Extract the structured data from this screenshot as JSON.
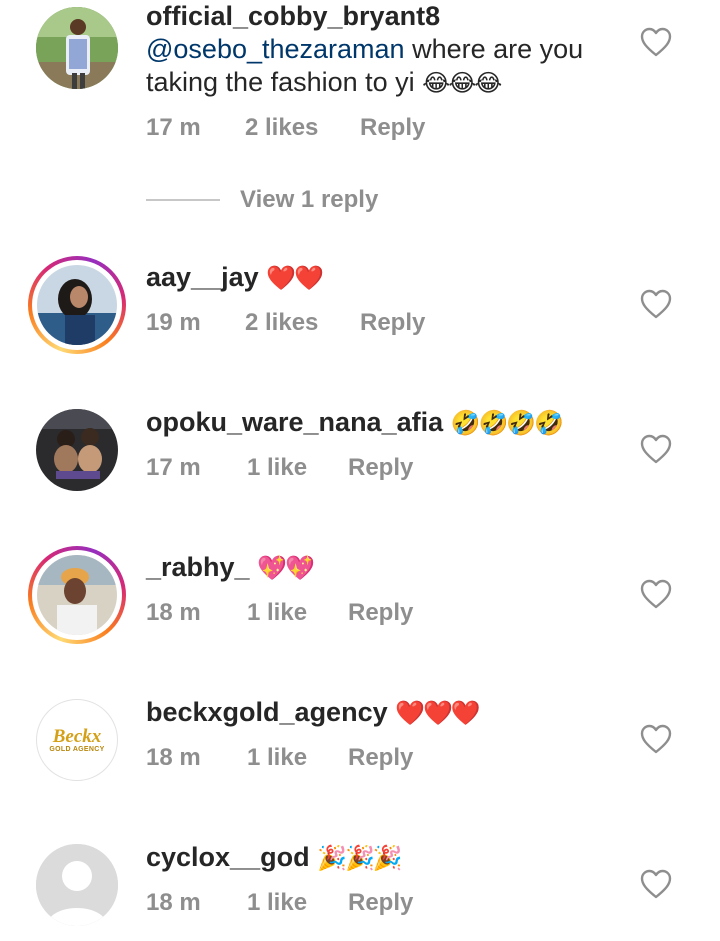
{
  "comments": [
    {
      "username": "official_cobby_bryant8",
      "mention": "@osebo_thezaraman",
      "text": " where are you taking the fashion to yi ",
      "emoji": "😂😂😂",
      "time": "17 m",
      "likes": "2 likes",
      "reply": "Reply",
      "view_replies": "View 1 reply"
    },
    {
      "username": "aay__jay",
      "emoji": "❤️❤️",
      "time": "19 m",
      "likes": "2 likes",
      "reply": "Reply"
    },
    {
      "username": "opoku_ware_nana_afia",
      "emoji": "🤣🤣🤣🤣",
      "time": "17 m",
      "likes": "1 like",
      "reply": "Reply"
    },
    {
      "username": "_rabhy_",
      "emoji": "💖💖",
      "time": "18 m",
      "likes": "1 like",
      "reply": "Reply"
    },
    {
      "username": "beckxgold_agency",
      "emoji": "❤️❤️❤️",
      "time": "18 m",
      "likes": "1 like",
      "reply": "Reply",
      "logo_text": "Beckx",
      "logo_sub": "GOLD AGENCY"
    },
    {
      "username": "cyclox__god",
      "emoji": "🎉🎉🎉",
      "time": "18 m",
      "likes": "1 like",
      "reply": "Reply"
    }
  ],
  "colors": {
    "username": "#262626",
    "mention": "#00376b",
    "meta": "#8e8e8e",
    "heart_outline": "#8e8e8e",
    "story_ring": "#d62976"
  }
}
